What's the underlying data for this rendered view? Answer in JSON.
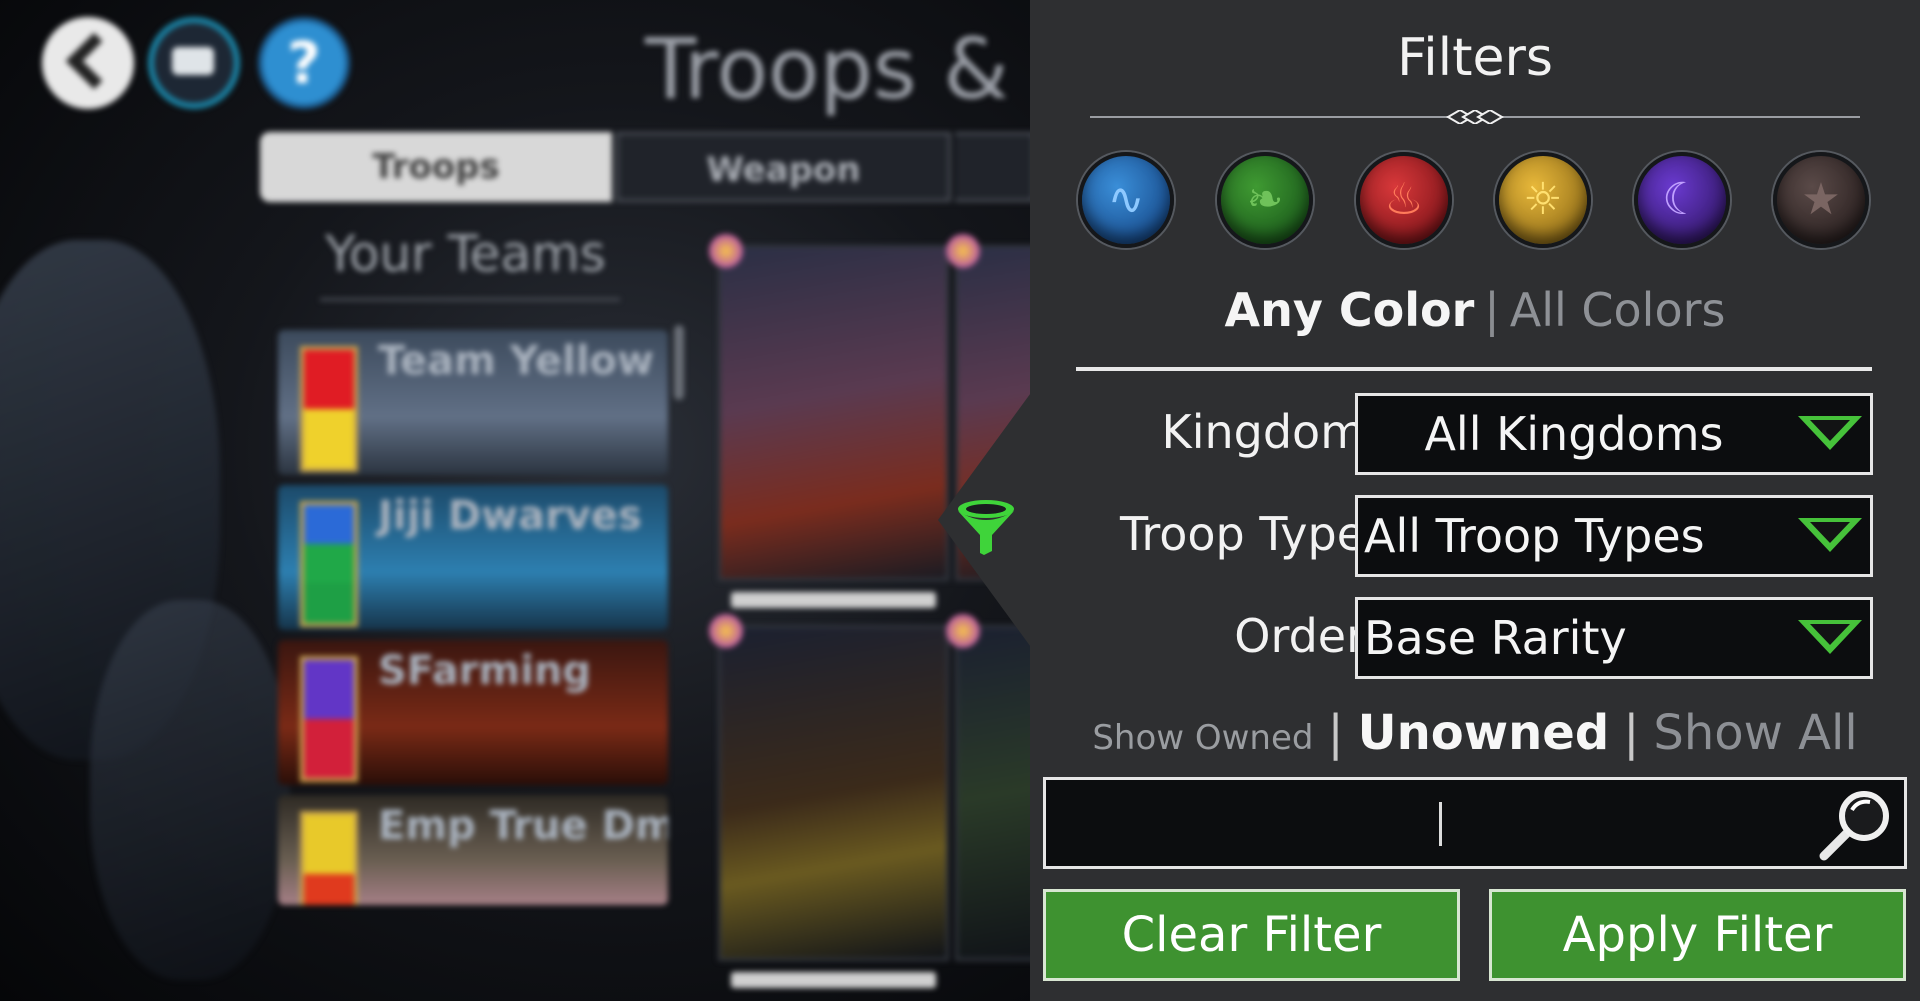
{
  "background_screen": {
    "title": "Troops & T",
    "tabs": [
      "Troops",
      "Weapon"
    ],
    "teams_heading": "Your Teams",
    "teams": [
      "Team Yellow",
      "Jiji Dwarves",
      "SFarming",
      "Emp True Dmg"
    ]
  },
  "filter_panel": {
    "title": "Filters",
    "color_orbs": [
      {
        "name": "blue",
        "color": "#1f5fae"
      },
      {
        "name": "green",
        "color": "#2e7a24"
      },
      {
        "name": "red",
        "color": "#b01e24"
      },
      {
        "name": "yellow",
        "color": "#c99a24"
      },
      {
        "name": "purple",
        "color": "#4a22a0"
      },
      {
        "name": "brown",
        "color": "#3a2e2c"
      }
    ],
    "color_mode": {
      "any": "Any Color",
      "separator": "|",
      "all": "All Colors",
      "selected": "Any Color"
    },
    "kingdom": {
      "label": "Kingdom",
      "value": "All Kingdoms"
    },
    "troop_type": {
      "label": "Troop Type",
      "value": "All Troop Types"
    },
    "order": {
      "label": "Order",
      "value": "Base Rarity"
    },
    "ownership": {
      "owned": "Show Owned",
      "separator": "|",
      "unowned": "Unowned",
      "all": "Show All",
      "selected": "Unowned"
    },
    "search": {
      "value": ""
    },
    "clear_button": "Clear Filter",
    "apply_button": "Apply Filter",
    "accent_color": "#46c23a",
    "button_color": "#3e9230"
  }
}
